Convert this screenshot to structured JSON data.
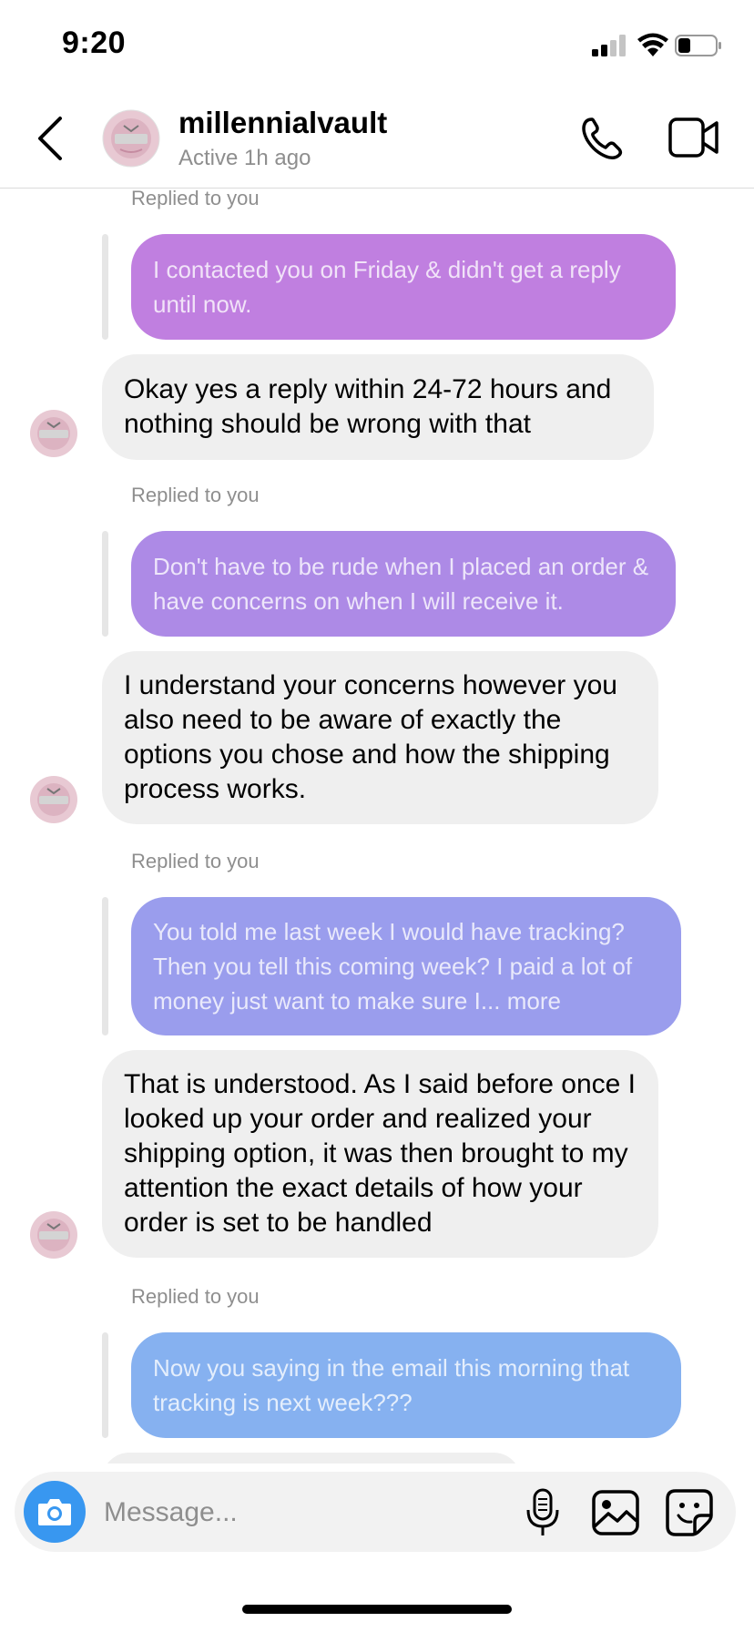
{
  "status": {
    "time": "9:20"
  },
  "header": {
    "name": "millennialvault",
    "status": "Active 1h ago"
  },
  "thread": {
    "replied_label": "Replied to you",
    "messages": [
      {
        "quoted": "I contacted you on Friday & didn't get a reply until now.",
        "reply": "Okay yes a reply within 24-72 hours and nothing should be wrong with that"
      },
      {
        "quoted": "Don't have to be rude when I placed an order & have concerns on when I will receive it.",
        "reply": "I understand your concerns however you also need to be aware of exactly the options you chose and how the shipping process works."
      },
      {
        "quoted": "You told me last week I would have tracking? Then you tell this coming week? I paid a lot of money just want to make sure I... more",
        "reply": "That is understood. As I said before once I looked up your order and realized your shipping option, it was then brought to my attention the exact details of how your order is set to be handled"
      },
      {
        "quoted": "Now you saying in the email this morning that tracking is next week???"
      }
    ]
  },
  "composer": {
    "placeholder": "Message..."
  },
  "colors": {
    "bubble_1": "#c07fe0",
    "bubble_2": "#ad8ae6",
    "bubble_3": "#9a9ded",
    "bubble_4": "#86b1f0",
    "incoming": "#efefef",
    "camera": "#3897f0"
  },
  "icons": [
    "chevron-left-icon",
    "phone-icon",
    "video-camera-icon",
    "camera-icon",
    "microphone-icon",
    "gallery-icon",
    "sticker-icon"
  ]
}
